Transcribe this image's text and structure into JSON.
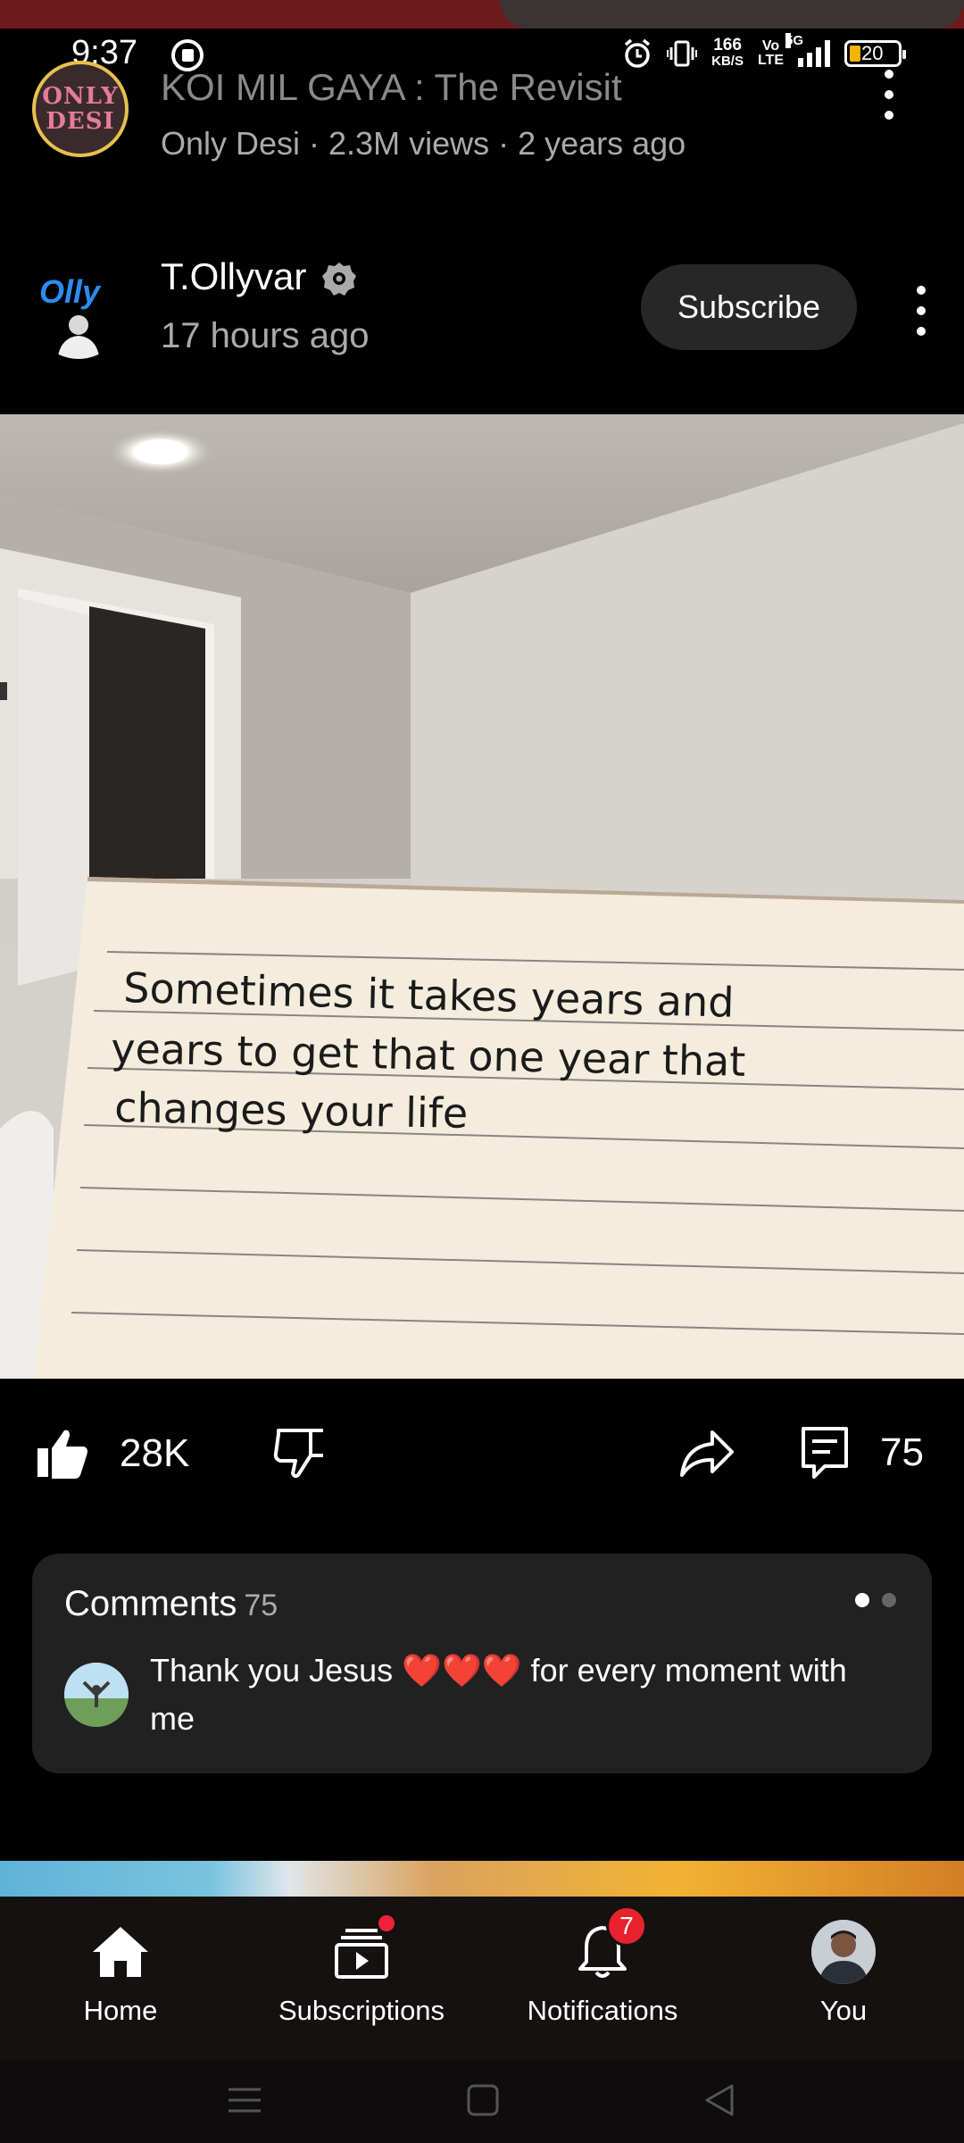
{
  "status_bar": {
    "time": "9:37",
    "speed_value": "166",
    "speed_unit": "KB/S",
    "volte_top": "Vo",
    "volte_bottom": "LTE",
    "network": "5G",
    "battery": "20"
  },
  "previous_video": {
    "avatar_line1": "ONLY",
    "avatar_line2": "DESI",
    "title": "KOI MIL GAYA : The Revisit",
    "meta": "Only Desi · 2.3M views · 2 years ago"
  },
  "post": {
    "channel_logo": "Olly",
    "channel_name": "T.Ollyvar",
    "posted": "17 hours ago",
    "subscribe_label": "Subscribe",
    "note_line1": "Sometimes it takes years and",
    "note_line2": "years to get that one year that",
    "note_line3": "changes your life"
  },
  "actions": {
    "likes": "28K",
    "comments": "75"
  },
  "comments": {
    "title": "Comments",
    "count": "75",
    "top_comment_before": "Thank you Jesus ",
    "top_comment_hearts": "❤️❤️❤️",
    "top_comment_after": " for every moment with me"
  },
  "bottom_nav": {
    "home": "Home",
    "subscriptions": "Subscriptions",
    "notifications": "Notifications",
    "notifications_badge": "7",
    "you": "You"
  },
  "colors": {
    "background": "#000000",
    "card": "#212121",
    "subscribe_bg": "#272727",
    "badge_red": "#e8222d",
    "battery_yellow": "#f4b400"
  }
}
